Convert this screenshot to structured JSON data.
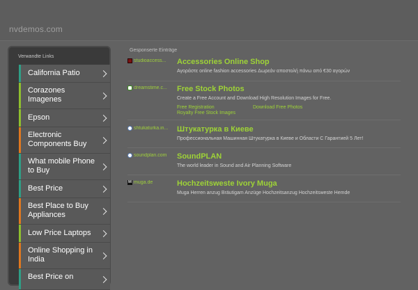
{
  "header": {
    "domain": "nvdemos.com"
  },
  "sidebar": {
    "title": "Verwandte Links",
    "items": [
      {
        "label": "California Patio",
        "color": "#2f9f86"
      },
      {
        "label": "Corazones Imagenes",
        "color": "#8fbf2e"
      },
      {
        "label": "Epson",
        "color": "#8fbf2e"
      },
      {
        "label": "Electronic Components Buy",
        "color": "#e07820"
      },
      {
        "label": "What mobile Phone to Buy",
        "color": "#2f9f86"
      },
      {
        "label": "Best Price",
        "color": "#2f9f86"
      },
      {
        "label": "Best Place to Buy Appliances",
        "color": "#e07820"
      },
      {
        "label": "Low Price Laptops",
        "color": "#8fbf2e"
      },
      {
        "label": "Online Shopping in India",
        "color": "#e07820"
      },
      {
        "label": "Best Price on",
        "color": "#2f9f86"
      }
    ]
  },
  "main": {
    "sponsored_label": "Gesponserte Einträge",
    "entries": [
      {
        "source": "studioaccess...",
        "icon": "red-square-icon",
        "title": "Accessories Online Shop",
        "desc": "Αγοράστε online fashion accessories Δωρεάν αποστολή πάνω από €30 αγορών"
      },
      {
        "source": "dreamstime.c...",
        "icon": "dreamstime-icon",
        "title": "Free Stock Photos",
        "desc": "Create a Free Account and Download High Resolution Images for Free.",
        "links": [
          "Free Registration",
          "Download Free Photos",
          "Royalty Free Stock Images"
        ]
      },
      {
        "source": "shtukaturka.in...",
        "icon": "globe-icon",
        "title": "Штукатурка в Киеве",
        "desc": "Профессиональная Машинная Штукатурка в Киеве и Области С Гарантией 5 Лет!"
      },
      {
        "source": "soundplan.com",
        "icon": "globe-icon",
        "title": "SoundPLAN",
        "desc": "The world leader in Sound and Air Planning Software"
      },
      {
        "source": "muga.de",
        "icon": "muga-icon",
        "icon_letter": "M",
        "title": "Hochzeitsweste Ivory Muga",
        "desc": "Muga Herren anzug Bräutigam Anzüge Hochzeitsanzug Hochzeitsweste Hemde"
      }
    ]
  }
}
